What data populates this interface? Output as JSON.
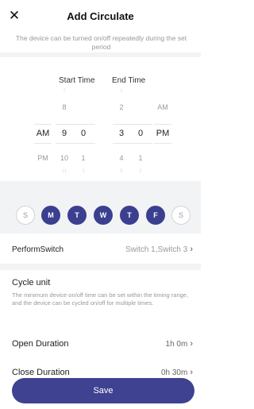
{
  "header": {
    "title": "Add Circulate",
    "close_glyph": "✕",
    "subtitle": "The device can be turned on/off repeatedly during the set period"
  },
  "picker": {
    "start_label": "Start Time",
    "end_label": "End Time",
    "start": {
      "ampm": {
        "above": "",
        "selected": "AM",
        "below": "PM"
      },
      "hour": {
        "top_faint": "7",
        "above": "8",
        "selected": "9",
        "below": "10",
        "bottom_faint": "11"
      },
      "minute": {
        "above": "",
        "selected": "0",
        "below": "1",
        "bottom_faint": "2"
      }
    },
    "end": {
      "hour": {
        "top_faint": "1",
        "above": "2",
        "selected": "3",
        "below": "4",
        "bottom_faint": "5"
      },
      "minute": {
        "above": "",
        "selected": "0",
        "below": "1",
        "bottom_faint": "2"
      },
      "ampm": {
        "above": "AM",
        "selected": "PM",
        "below": ""
      }
    }
  },
  "days": [
    {
      "label": "S",
      "active": false
    },
    {
      "label": "M",
      "active": true
    },
    {
      "label": "T",
      "active": true
    },
    {
      "label": "W",
      "active": true
    },
    {
      "label": "T",
      "active": true
    },
    {
      "label": "F",
      "active": true
    },
    {
      "label": "S",
      "active": false
    }
  ],
  "perform_switch": {
    "label": "PerformSwitch",
    "value": "Switch 1,Switch 3",
    "chevron": "›"
  },
  "cycle": {
    "title": "Cycle unit",
    "description": "The minimum device on/off time can be set within the timing range, and the device can be cycled on/off for multiple times."
  },
  "open_duration": {
    "label": "Open Duration",
    "value": "1h 0m",
    "chevron": "›"
  },
  "close_duration": {
    "label": "Close Duration",
    "value": "0h 30m",
    "chevron": "›"
  },
  "save_label": "Save",
  "colors": {
    "accent": "#3b3f8f",
    "band": "#f2f3f5",
    "muted": "#999999"
  }
}
